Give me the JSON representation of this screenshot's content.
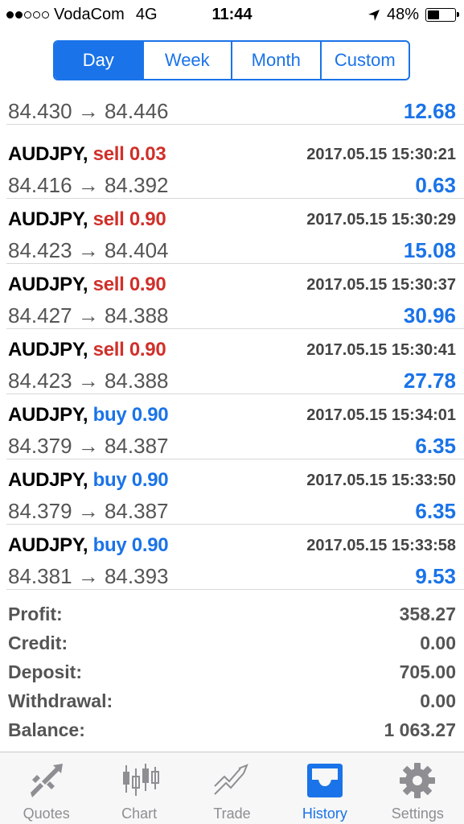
{
  "status": {
    "carrier": "VodaCom",
    "network": "4G",
    "time": "11:44",
    "battery": "48%",
    "battery_level": 0.48,
    "signal_bars_filled": 2,
    "signal_bars_total": 5
  },
  "period_tabs": [
    {
      "label": "Day",
      "active": true
    },
    {
      "label": "Week",
      "active": false
    },
    {
      "label": "Month",
      "active": false
    },
    {
      "label": "Custom",
      "active": false
    }
  ],
  "partial_row": {
    "prices": "84.430 → 84.446",
    "profit": "12.68"
  },
  "orders": [
    {
      "symbol": "AUDJPY,",
      "side": "sell",
      "volume": "sell 0.03",
      "time": "2017.05.15 15:30:21",
      "prices": "84.416 → 84.392",
      "profit": "0.63"
    },
    {
      "symbol": "AUDJPY,",
      "side": "sell",
      "volume": "sell 0.90",
      "time": "2017.05.15 15:30:29",
      "prices": "84.423 → 84.404",
      "profit": "15.08"
    },
    {
      "symbol": "AUDJPY,",
      "side": "sell",
      "volume": "sell 0.90",
      "time": "2017.05.15 15:30:37",
      "prices": "84.427 → 84.388",
      "profit": "30.96"
    },
    {
      "symbol": "AUDJPY,",
      "side": "sell",
      "volume": "sell 0.90",
      "time": "2017.05.15 15:30:41",
      "prices": "84.423 → 84.388",
      "profit": "27.78"
    },
    {
      "symbol": "AUDJPY,",
      "side": "buy",
      "volume": "buy 0.90",
      "time": "2017.05.15 15:34:01",
      "prices": "84.379 → 84.387",
      "profit": "6.35"
    },
    {
      "symbol": "AUDJPY,",
      "side": "buy",
      "volume": "buy 0.90",
      "time": "2017.05.15 15:33:50",
      "prices": "84.379 → 84.387",
      "profit": "6.35"
    },
    {
      "symbol": "AUDJPY,",
      "side": "buy",
      "volume": "buy 0.90",
      "time": "2017.05.15 15:33:58",
      "prices": "84.381 → 84.393",
      "profit": "9.53"
    }
  ],
  "summary": [
    {
      "label": "Profit:",
      "value": "358.27"
    },
    {
      "label": "Credit:",
      "value": "0.00"
    },
    {
      "label": "Deposit:",
      "value": "705.00"
    },
    {
      "label": "Withdrawal:",
      "value": "0.00"
    },
    {
      "label": "Balance:",
      "value": "1 063.27"
    }
  ],
  "tabbar": [
    {
      "label": "Quotes",
      "icon": "quotes-arrows-icon",
      "active": false
    },
    {
      "label": "Chart",
      "icon": "candlestick-chart-icon",
      "active": false
    },
    {
      "label": "Trade",
      "icon": "trade-trend-icon",
      "active": false
    },
    {
      "label": "History",
      "icon": "history-inbox-icon",
      "active": true
    },
    {
      "label": "Settings",
      "icon": "gear-icon",
      "active": false
    }
  ],
  "colors": {
    "accent": "#1a73e8",
    "sell": "#d0302a",
    "buy": "#1a73e8",
    "inactive_tab": "#8e8e93"
  }
}
